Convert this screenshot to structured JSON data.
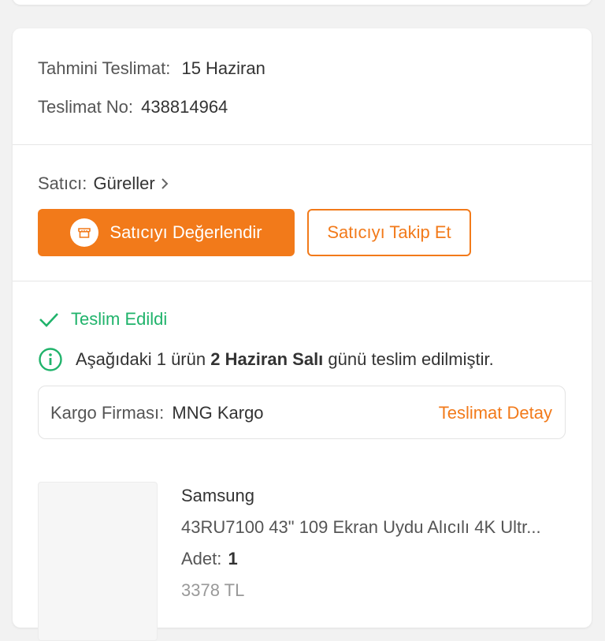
{
  "delivery": {
    "estimated_label": "Tahmini Teslimat:",
    "estimated_value": "15 Haziran",
    "number_label": "Teslimat No:",
    "number_value": "438814964"
  },
  "seller": {
    "label": "Satıcı:",
    "name": "Güreller",
    "rate_button": "Satıcıyı Değerlendir",
    "follow_button": "Satıcıyı Takip Et"
  },
  "status": {
    "text": "Teslim Edildi",
    "info_prefix": "Aşağıdaki 1 ürün ",
    "info_bold": "2 Haziran Salı",
    "info_suffix": " günü teslim edilmiştir."
  },
  "cargo": {
    "label": "Kargo Firması:",
    "company": "MNG Kargo",
    "detail_link": "Teslimat Detay"
  },
  "product": {
    "brand": "Samsung",
    "name": "43RU7100 43\" 109 Ekran Uydu Alıcılı 4K Ultr...",
    "qty_label": "Adet:",
    "qty_value": "1",
    "price": "3378 TL"
  },
  "colors": {
    "accent": "#f27a1a",
    "success": "#20b36b",
    "background": "#f2f2f2"
  }
}
